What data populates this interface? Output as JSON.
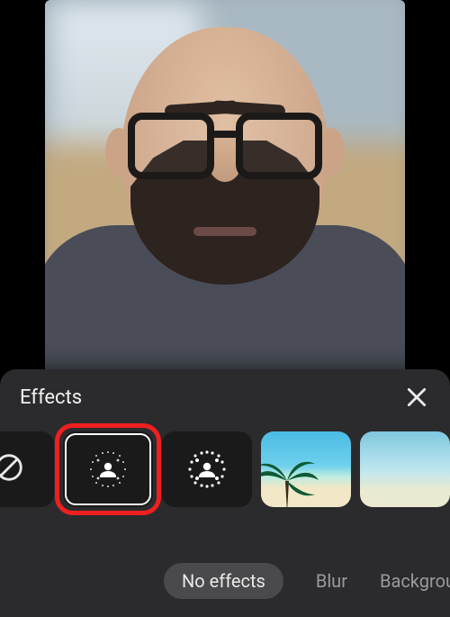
{
  "sheet": {
    "title": "Effects",
    "close_name": "close"
  },
  "tiles": [
    {
      "id": "no-effect",
      "kind": "none",
      "name": "no-effect-tile"
    },
    {
      "id": "blur-light",
      "kind": "blur",
      "name": "slight-blur-tile",
      "selected": true
    },
    {
      "id": "blur-strong",
      "kind": "blur2",
      "name": "blur-tile"
    },
    {
      "id": "bg-beach",
      "kind": "image",
      "name": "background-beach-tile"
    },
    {
      "id": "bg-beach-2",
      "kind": "image",
      "name": "background-beach-2-tile"
    }
  ],
  "categories": {
    "items": [
      "No effects",
      "Blur",
      "Backgrounds"
    ],
    "active_index": 0
  }
}
